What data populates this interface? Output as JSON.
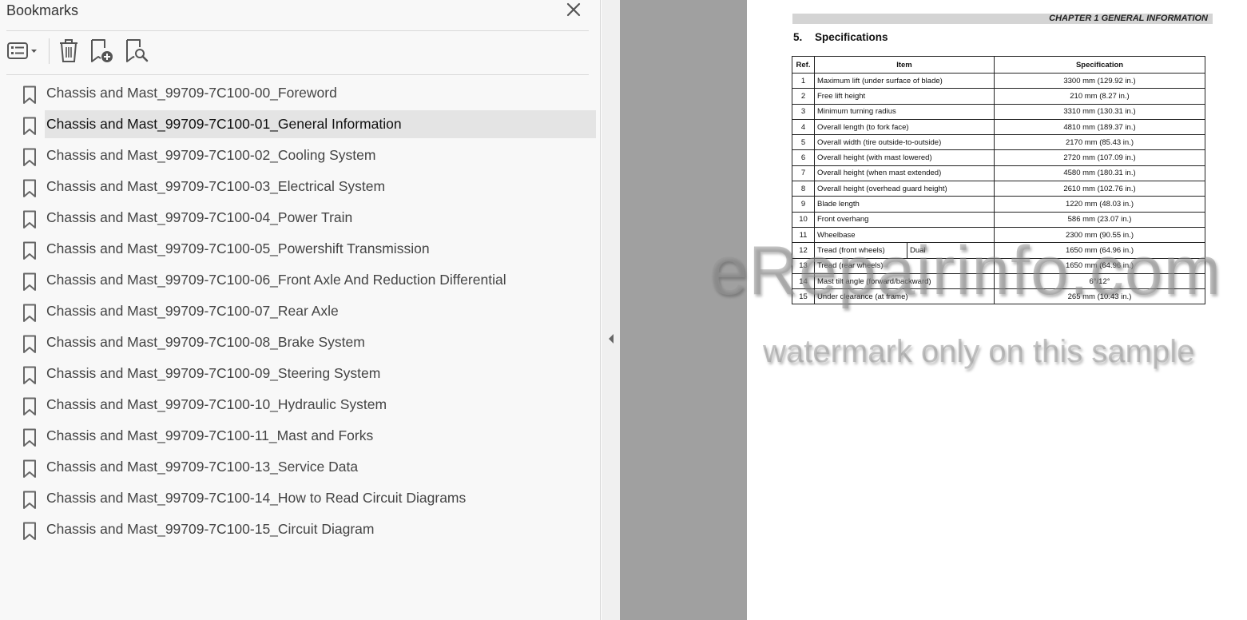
{
  "bookmarks_panel": {
    "title": "Bookmarks",
    "toolbar": {
      "options_icon": "list-options-icon",
      "delete_icon": "trash-icon",
      "new_bookmark_icon": "bookmark-add-icon",
      "find_bookmark_icon": "bookmark-search-icon"
    },
    "selected_index": 1,
    "items": [
      {
        "label": "Chassis and Mast_99709-7C100-00_Foreword"
      },
      {
        "label": "Chassis and Mast_99709-7C100-01_General Information"
      },
      {
        "label": "Chassis and Mast_99709-7C100-02_Cooling System"
      },
      {
        "label": "Chassis and Mast_99709-7C100-03_Electrical System"
      },
      {
        "label": "Chassis and Mast_99709-7C100-04_Power Train"
      },
      {
        "label": "Chassis and Mast_99709-7C100-05_Powershift Transmission"
      },
      {
        "label": "Chassis and Mast_99709-7C100-06_Front Axle And Reduction Differential"
      },
      {
        "label": "Chassis and Mast_99709-7C100-07_Rear Axle"
      },
      {
        "label": "Chassis and Mast_99709-7C100-08_Brake System"
      },
      {
        "label": "Chassis and Mast_99709-7C100-09_Steering System"
      },
      {
        "label": "Chassis and Mast_99709-7C100-10_Hydraulic System"
      },
      {
        "label": "Chassis and Mast_99709-7C100-11_Mast and Forks"
      },
      {
        "label": "Chassis and Mast_99709-7C100-13_Service Data"
      },
      {
        "label": "Chassis and Mast_99709-7C100-14_How to Read Circuit Diagrams"
      },
      {
        "label": "Chassis and Mast_99709-7C100-15_Circuit Diagram"
      }
    ]
  },
  "document": {
    "chapter_header": "CHAPTER 1 GENERAL INFORMATION",
    "section_number": "5.",
    "section_title": "Specifications",
    "table": {
      "headers": {
        "ref": "Ref.",
        "item": "Item",
        "spec": "Specification"
      },
      "rows": [
        {
          "ref": "1",
          "item": "Maximum lift (under surface of blade)",
          "spec": "3300 mm (129.92 in.)"
        },
        {
          "ref": "2",
          "item": "Free lift height",
          "spec": "210 mm (8.27 in.)"
        },
        {
          "ref": "3",
          "item": "Minimum turning radius",
          "spec": "3310 mm (130.31 in.)"
        },
        {
          "ref": "4",
          "item": "Overall length (to fork face)",
          "spec": "4810 mm (189.37 in.)"
        },
        {
          "ref": "5",
          "item": "Overall width (tire outside-to-outside)",
          "spec": "2170 mm (85.43 in.)"
        },
        {
          "ref": "6",
          "item": "Overall height (with mast lowered)",
          "spec": "2720 mm (107.09 in.)"
        },
        {
          "ref": "7",
          "item": "Overall height (when mast extended)",
          "spec": "4580 mm (180.31 in.)"
        },
        {
          "ref": "8",
          "item": "Overall height (overhead guard height)",
          "spec": "2610 mm (102.76 in.)"
        },
        {
          "ref": "9",
          "item": "Blade length",
          "spec": "1220 mm (48.03 in.)"
        },
        {
          "ref": "10",
          "item": "Front overhang",
          "spec": "586 mm (23.07 in.)"
        },
        {
          "ref": "11",
          "item": "Wheelbase",
          "spec": "2300 mm (90.55 in.)"
        },
        {
          "ref": "12",
          "item": "Tread (front wheels)",
          "sub": "Dual",
          "spec": "1650 mm (64.96 in.)"
        },
        {
          "ref": "13",
          "item": "Tread (rear wheels)",
          "spec": "1650 mm (64.96 in.)"
        },
        {
          "ref": "14",
          "item": "Mast tilt angle (forward/backward)",
          "spec": "6°/12°"
        },
        {
          "ref": "15",
          "item": "Under clearance (at frame)",
          "spec": "265 mm (10.43 in.)"
        }
      ]
    }
  },
  "watermark": {
    "main": "eRepairinfo.com",
    "sub": "watermark only on this sample"
  }
}
